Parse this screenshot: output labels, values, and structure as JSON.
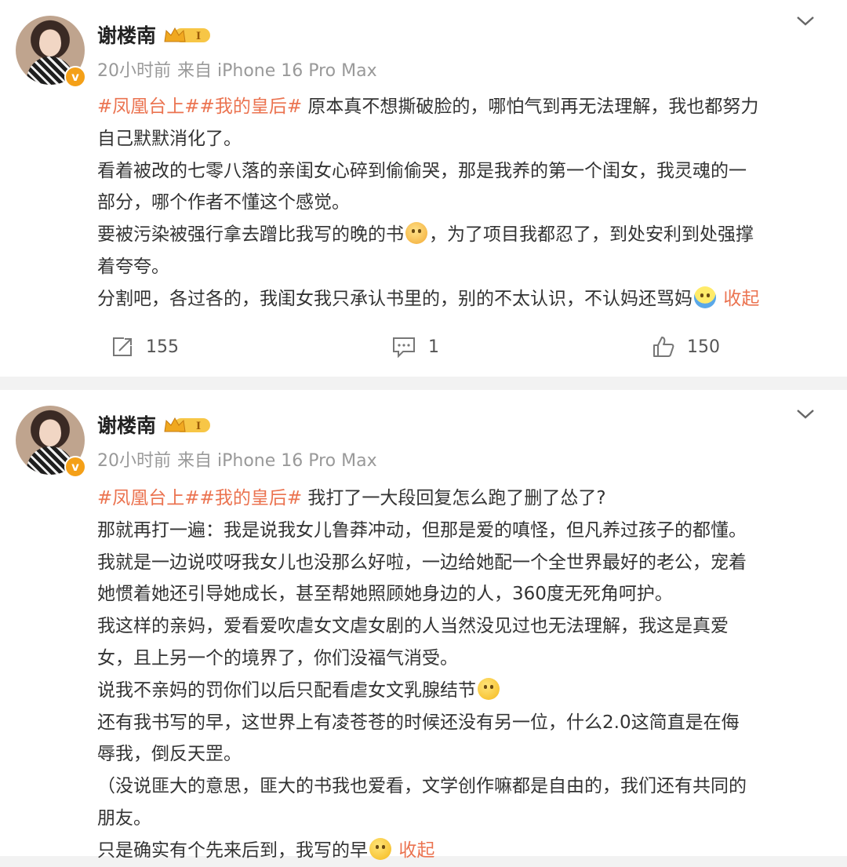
{
  "posts": [
    {
      "username": "谢楼南",
      "level_badge": "I",
      "verified": "v",
      "time": "20小时前",
      "source": "来自 iPhone 16 Pro Max",
      "tag1": "#凤凰台上#",
      "tag2": "#我的皇后#",
      "lines": {
        "l1": "原本真不想撕破脸的，哪怕气到再无法理解，我也都努力",
        "l2": "自己默默消化了。",
        "l3": "看着被改的七零八落的亲闺女心碎到偷偷哭，那是我养的第一个闺女，我灵魂的一",
        "l4": "部分，哪个作者不懂这个感觉。",
        "l5a": "要被污染被强行拿去蹭比我写的晚的书",
        "l5b": "，为了项目我都忍了，到处安利到处强撑",
        "l6": "着夸夸。",
        "l7": "分割吧，各过各的，我闺女我只承认书里的，别的不太认识，不认妈还骂妈"
      },
      "fold_label": "收起",
      "repost_count": "155",
      "comment_count": "1",
      "like_count": "150"
    },
    {
      "username": "谢楼南",
      "level_badge": "I",
      "verified": "v",
      "time": "20小时前",
      "source": "来自 iPhone 16 Pro Max",
      "tag1": "#凤凰台上#",
      "tag2": "#我的皇后#",
      "lines": {
        "l1": "我打了一大段回复怎么跑了删了怂了?",
        "l2": "那就再打一遍：我是说我女儿鲁莽冲动，但那是爱的嗔怪，但凡养过孩子的都懂。",
        "l3": "我就是一边说哎呀我女儿也没那么好啦，一边给她配一个全世界最好的老公，宠着",
        "l4": "她惯着她还引导她成长，甚至帮她照顾她身边的人，360度无死角呵护。",
        "l5": "我这样的亲妈，爱看爱吹虐女文虐女剧的人当然没见过也无法理解，我这是真爱",
        "l6": "女，且上另一个的境界了，你们没福气消受。",
        "l7": "说我不亲妈的罚你们以后只配看虐女文乳腺结节",
        "l8": "还有我书写的早，这世界上有凌苍苍的时候还没有另一位，什么2.0这简直是在侮",
        "l9": "辱我，倒反天罡。",
        "l10": "（没说匪大的意思，匪大的书我也爱看，文学创作嘛都是自由的，我们还有共同的",
        "l11": "朋友。",
        "l12": "只是确实有个先来后到，我写的早"
      },
      "fold_label": "收起"
    }
  ],
  "icons": {
    "repost": "repost-icon",
    "comment": "comment-icon",
    "like": "like-icon",
    "menu": "chevron-down-icon"
  },
  "colors": {
    "tag": "#eb7350",
    "badge": "#f4a018",
    "meta": "#999999"
  }
}
